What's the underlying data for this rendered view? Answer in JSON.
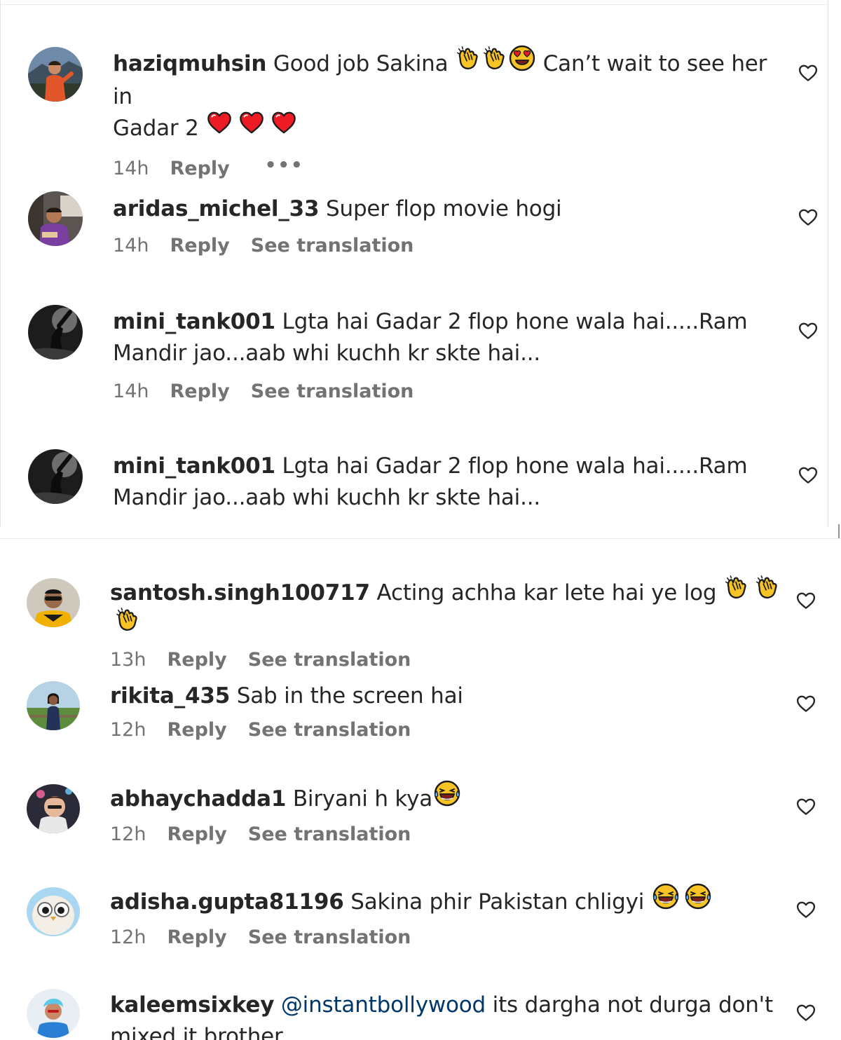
{
  "top_comments": [
    {
      "username": "haziqmuhsin",
      "text_before": "Good job Sakina ",
      "text_mid": " Can’t wait to see her in",
      "text_line2": "Gadar 2 ",
      "time": "14h",
      "reply": "Reply",
      "more": "•••"
    },
    {
      "username": "aridas_michel_33",
      "text": "Super flop movie hogi",
      "time": "14h",
      "reply": "Reply",
      "translation": "See translation"
    },
    {
      "username": "mini_tank001",
      "text_line1": "Lgta hai Gadar 2 flop hone wala hai.....Ram",
      "text_line2": "Mandir jao...aab whi kuchh kr skte hai...",
      "time": "14h",
      "reply": "Reply",
      "translation": "See translation"
    },
    {
      "username": "mini_tank001",
      "text_line1": "Lgta hai Gadar 2 flop hone wala hai.....Ram",
      "text_line2": "Mandir jao...aab whi kuchh kr skte hai..."
    }
  ],
  "bottom_comments": [
    {
      "username": "santosh.singh100717",
      "text": "Acting achha kar lete hai ye log ",
      "time": "13h",
      "reply": "Reply",
      "translation": "See translation"
    },
    {
      "username": "rikita_435",
      "text": "Sab in the screen hai",
      "time": "12h",
      "reply": "Reply",
      "translation": "See translation"
    },
    {
      "username": "abhaychadda1",
      "text": "Biryani h kya",
      "time": "12h",
      "reply": "Reply",
      "translation": "See translation"
    },
    {
      "username": "adisha.gupta81196",
      "text": "Sakina phir Pakistan chligyi ",
      "time": "12h",
      "reply": "Reply",
      "translation": "See translation"
    },
    {
      "username": "kaleemsixkey",
      "mention": "@instantbollywood",
      "text": "its dargha not durga don't",
      "text_line2": "mixed it brother"
    }
  ],
  "icons": {
    "like": "heart-outline-icon",
    "clap": "clapping-hands-emoji",
    "heart_eyes": "heart-eyes-emoji",
    "red_heart": "red-heart-emoji",
    "laugh": "tears-of-joy-emoji"
  },
  "colors": {
    "text": "#262626",
    "meta": "#737373",
    "mention": "#00376b",
    "heart": "#ed1c24",
    "emoji": "#f7c325"
  }
}
